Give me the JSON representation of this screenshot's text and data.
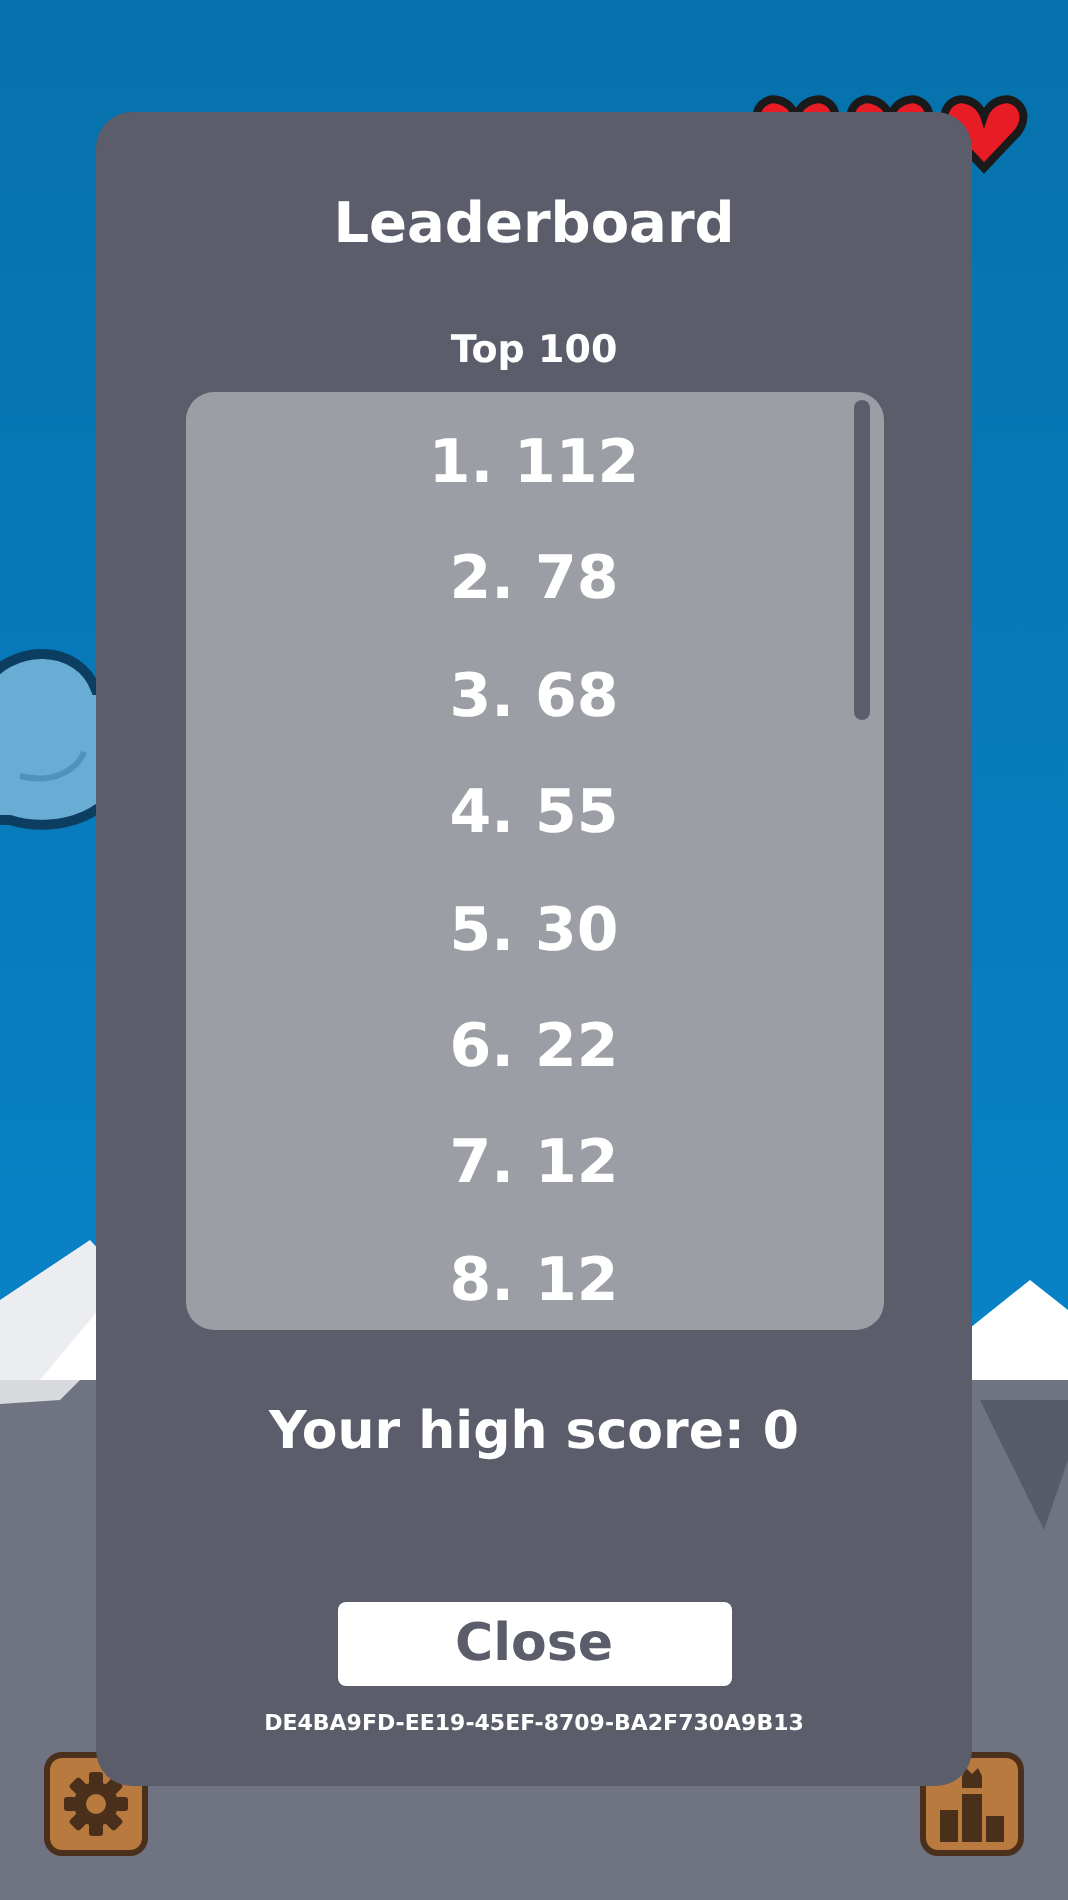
{
  "dialog": {
    "title": "Leaderboard",
    "subtitle": "Top 100",
    "scores": [
      "1. 112",
      "2. 78",
      "3. 68",
      "4. 55",
      "5. 30",
      "6. 22",
      "7. 12",
      "8. 12"
    ],
    "high_score": "Your high score: 0",
    "close_button": "Close",
    "player_id": "DE4BA9FD-EE19-45EF-8709-BA2F730A9B13"
  }
}
